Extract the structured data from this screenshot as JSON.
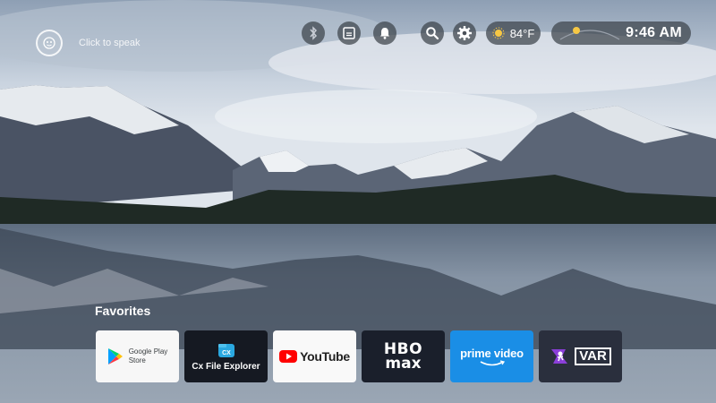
{
  "voice": {
    "label": "Click to speak"
  },
  "status": {
    "weather_icon": "sun-icon",
    "temperature": "84°F",
    "time": "9:46 AM"
  },
  "toolbar": {
    "icons": [
      "bluetooth-icon",
      "input-source-icon",
      "bell-icon",
      "search-icon",
      "gear-icon"
    ]
  },
  "favorites": {
    "title": "Favorites",
    "apps": [
      {
        "name": "Google Play Store",
        "line1": "Google Play",
        "line2": "Store"
      },
      {
        "name": "Cx File Explorer",
        "label": "Cx File Explorer"
      },
      {
        "name": "YouTube",
        "label": "YouTube"
      },
      {
        "name": "HBO Max",
        "top": "HBO",
        "bottom": "max"
      },
      {
        "name": "Prime Video",
        "label": "prime video"
      },
      {
        "name": "VAR",
        "label": "VAR"
      }
    ]
  },
  "colors": {
    "youtube_red": "#ff0000",
    "prime_blue": "#1a8ee6",
    "var_purple": "#8b3fd9"
  }
}
